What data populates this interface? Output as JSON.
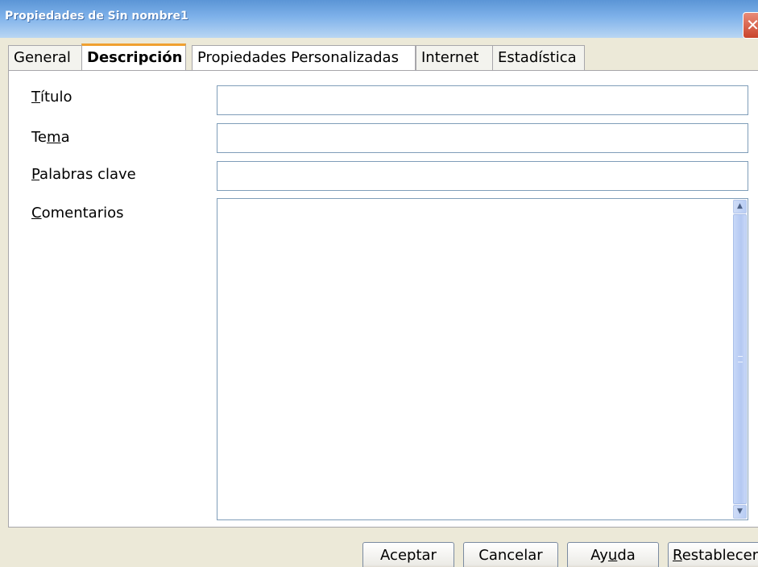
{
  "window": {
    "title": "Propiedades de  Sin nombre1",
    "close_glyph": "✕"
  },
  "tabs": [
    {
      "label": "General",
      "active": false
    },
    {
      "label": "Descripción",
      "active": true
    },
    {
      "label": "Propiedades Personalizadas",
      "active": false
    },
    {
      "label": "Internet",
      "active": false
    },
    {
      "label": "Estadística",
      "active": false
    }
  ],
  "form": {
    "titulo": {
      "label_mnemonic": "T",
      "label_rest": "ítulo",
      "value": ""
    },
    "tema": {
      "label_pre": "Te",
      "label_mnemonic": "m",
      "label_post": "a",
      "value": ""
    },
    "palabras": {
      "label_mnemonic": "P",
      "label_rest": "alabras clave",
      "value": ""
    },
    "comentarios": {
      "label_mnemonic": "C",
      "label_rest": "omentarios",
      "value": ""
    }
  },
  "buttons": {
    "aceptar": "Aceptar",
    "cancelar": "Cancelar",
    "ayuda_pre": "Ay",
    "ayuda_mnemonic": "u",
    "ayuda_post": "da",
    "restablecer_mnemonic": "R",
    "restablecer_rest": "establecer"
  },
  "icons": {
    "close": "close-icon",
    "scroll_up": "scroll-up-arrow-icon",
    "scroll_down": "scroll-down-arrow-icon"
  },
  "colors": {
    "titlebar": "#5b95d6",
    "close_button": "#c9442b",
    "active_tab_accent": "#f0a030",
    "field_border": "#7f9db9"
  }
}
